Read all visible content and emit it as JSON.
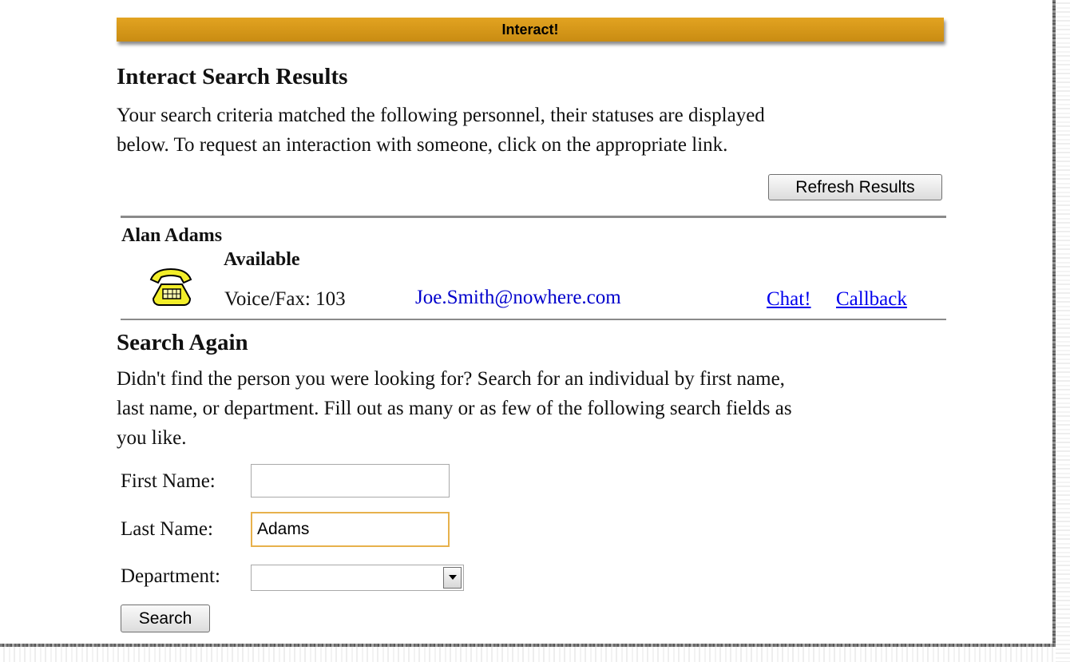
{
  "banner": {
    "title": "Interact!"
  },
  "results": {
    "heading": "Interact Search Results",
    "description_line1": "Your search criteria matched the following personnel, their statuses are displayed",
    "description_line2": "below. To request an interaction with someone, click on the appropriate link.",
    "refresh_label": "Refresh Results",
    "person": {
      "name": "Alan Adams",
      "status": "Available",
      "icon": "telephone-icon",
      "voice_fax": "Voice/Fax: 103",
      "email": "Joe.Smith@nowhere.com",
      "chat_label": "Chat!",
      "callback_label": "Callback"
    }
  },
  "search": {
    "heading": "Search Again",
    "description_line1": "Didn't find the person you were looking for? Search for an individual by first name,",
    "description_line2": "last name, or department. Fill out as many or as few of the following search fields as",
    "description_line3": "you like.",
    "first_name_label": "First Name:",
    "first_name_value": "",
    "last_name_label": "Last Name:",
    "last_name_value": "Adams",
    "department_label": "Department:",
    "department_value": "",
    "search_label": "Search"
  },
  "colors": {
    "banner": "#d89a1a",
    "link": "#0000ee",
    "email": "#0000cc",
    "focus_border": "#e7b14c"
  }
}
